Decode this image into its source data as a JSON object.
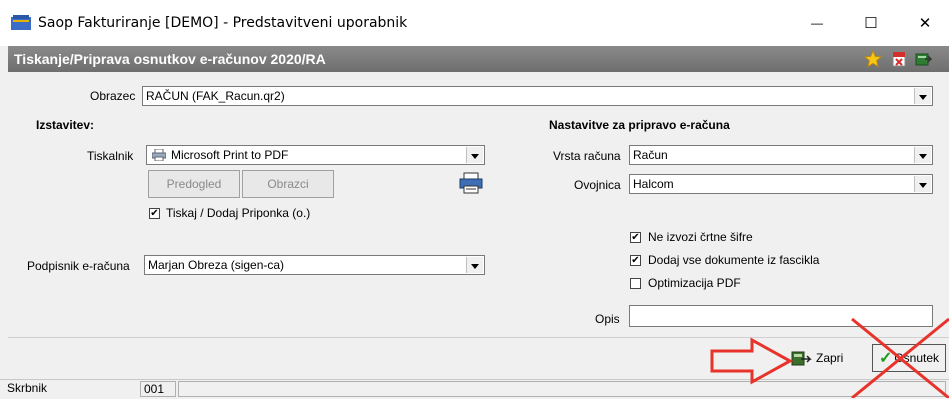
{
  "window": {
    "title": "Saop Fakturiranje [DEMO] - Predstavitveni uporabnik",
    "minimize_glyph": "—",
    "maximize_glyph": "☐",
    "close_glyph": "✕"
  },
  "header": {
    "title": "Tiskanje/Priprava osnutkov e-računov 2020/RA",
    "icons": [
      "star-icon",
      "pdf-delete-icon",
      "book-exit-icon"
    ]
  },
  "form": {
    "obrazec_label": "Obrazec",
    "obrazec_value": "RAČUN  (FAK_Racun.qr2)",
    "issuer_heading": "Izstavitev:",
    "tiskalnik_label": "Tiskalnik",
    "tiskalnik_value": "Microsoft Print to PDF",
    "predogled_label": "Predogled",
    "obrazci_label": "Obrazci",
    "tiskaj_label": "Tiskaj / Dodaj Priponka (o.)",
    "tiskaj_checked": true,
    "podpisnik_label": "Podpisnik e-računa",
    "podpisnik_value": "Marjan Obreza (sigen-ca)",
    "settings_heading": "Nastavitve za pripravo e-računa",
    "vrsta_label": "Vrsta računa",
    "vrsta_value": "Račun",
    "ovojnica_label": "Ovojnica",
    "ovojnica_value": "Halcom",
    "ne_izvozi_label": "Ne izvozi črtne šifre",
    "ne_izvozi_checked": true,
    "dodaj_vse_label": "Dodaj vse dokumente iz fascikla",
    "dodaj_vse_checked": true,
    "optimizacija_label": "Optimizacija PDF",
    "optimizacija_checked": false,
    "opis_label": "Opis",
    "opis_value": ""
  },
  "footer": {
    "zapri_label": "Zapri",
    "osnutek_label": "Osnutek"
  },
  "status": {
    "user": "Skrbnik",
    "code": "001"
  },
  "annotations": {
    "arrow_color": "#e8332a",
    "cross_color": "#e8332a"
  }
}
